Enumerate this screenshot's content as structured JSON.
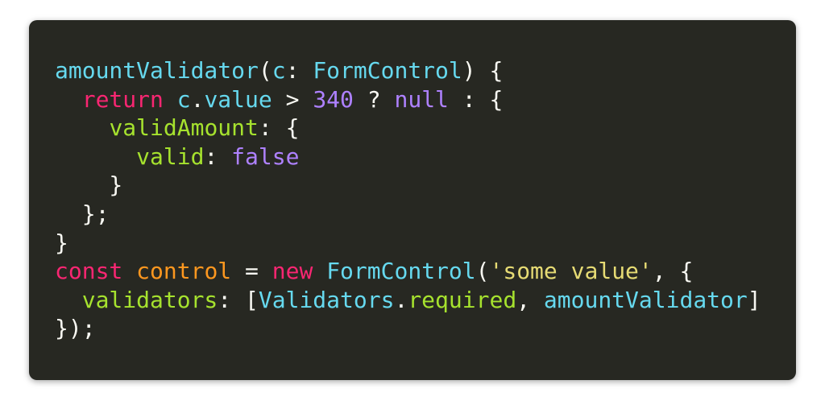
{
  "snippet": {
    "lines": [
      [
        {
          "t": "amountValidator",
          "k": "fn"
        },
        {
          "t": "(",
          "k": "pun"
        },
        {
          "t": "c",
          "k": "fn"
        },
        {
          "t": ": ",
          "k": "pun"
        },
        {
          "t": "FormControl",
          "k": "fn"
        },
        {
          "t": ") {",
          "k": "pun"
        }
      ],
      [
        {
          "t": "  ",
          "k": "pun"
        },
        {
          "t": "return",
          "k": "kw"
        },
        {
          "t": " ",
          "k": "pun"
        },
        {
          "t": "c",
          "k": "fn"
        },
        {
          "t": ".",
          "k": "pun"
        },
        {
          "t": "value",
          "k": "fn"
        },
        {
          "t": " > ",
          "k": "pun"
        },
        {
          "t": "340",
          "k": "num"
        },
        {
          "t": " ? ",
          "k": "pun"
        },
        {
          "t": "null",
          "k": "num"
        },
        {
          "t": " : {",
          "k": "pun"
        }
      ],
      [
        {
          "t": "    ",
          "k": "pun"
        },
        {
          "t": "validAmount",
          "k": "prop"
        },
        {
          "t": ": {",
          "k": "pun"
        }
      ],
      [
        {
          "t": "      ",
          "k": "pun"
        },
        {
          "t": "valid",
          "k": "prop"
        },
        {
          "t": ": ",
          "k": "pun"
        },
        {
          "t": "false",
          "k": "num"
        }
      ],
      [
        {
          "t": "    }",
          "k": "pun"
        }
      ],
      [
        {
          "t": "  };",
          "k": "pun"
        }
      ],
      [
        {
          "t": "}",
          "k": "pun"
        }
      ],
      [
        {
          "t": "const",
          "k": "kw"
        },
        {
          "t": " ",
          "k": "pun"
        },
        {
          "t": "control",
          "k": "var"
        },
        {
          "t": " = ",
          "k": "pun"
        },
        {
          "t": "new",
          "k": "kw"
        },
        {
          "t": " ",
          "k": "pun"
        },
        {
          "t": "FormControl",
          "k": "fn"
        },
        {
          "t": "(",
          "k": "pun"
        },
        {
          "t": "'some value'",
          "k": "str"
        },
        {
          "t": ", {",
          "k": "pun"
        }
      ],
      [
        {
          "t": "  ",
          "k": "pun"
        },
        {
          "t": "validators",
          "k": "prop"
        },
        {
          "t": ": [",
          "k": "pun"
        },
        {
          "t": "Validators",
          "k": "fn"
        },
        {
          "t": ".",
          "k": "pun"
        },
        {
          "t": "required",
          "k": "prop"
        },
        {
          "t": ", ",
          "k": "pun"
        },
        {
          "t": "amountValidator",
          "k": "fn"
        },
        {
          "t": "]",
          "k": "pun"
        }
      ],
      [
        {
          "t": "});",
          "k": "pun"
        }
      ]
    ]
  },
  "theme": {
    "background": "#272822",
    "page_background": "#ffffff",
    "colors": {
      "fn": "#66d9ef",
      "kw": "#f92672",
      "num": "#ae81ff",
      "prop": "#a6e22e",
      "var": "#fd971f",
      "str": "#e6db74",
      "pun": "#f8f8f2"
    }
  }
}
